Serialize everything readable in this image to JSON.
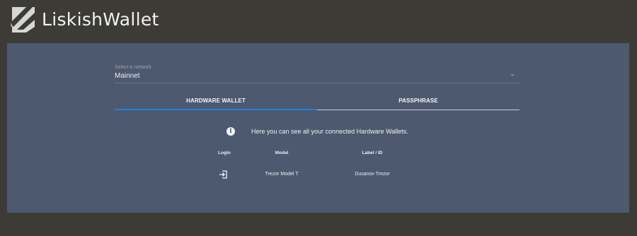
{
  "app": {
    "name": "LiskishWallet"
  },
  "network": {
    "label": "Select a network",
    "value": "Mainnet"
  },
  "tabs": [
    {
      "label": "HARDWARE WALLET",
      "active": true
    },
    {
      "label": "PASSPHRASE",
      "active": false
    }
  ],
  "info": {
    "icon": "info-icon",
    "message": "Here you can see all your connected Hardware Wallets."
  },
  "table": {
    "headers": [
      "Login",
      "Model",
      "Label / ID"
    ],
    "rows": [
      {
        "login_icon": "login-icon",
        "model": "Trezor Model T",
        "label": "Dusanov Trezor"
      }
    ]
  },
  "colors": {
    "background": "#3c3b36",
    "card": "#4d596f",
    "accent": "#1f7fe0",
    "text": "#eef0f4"
  }
}
